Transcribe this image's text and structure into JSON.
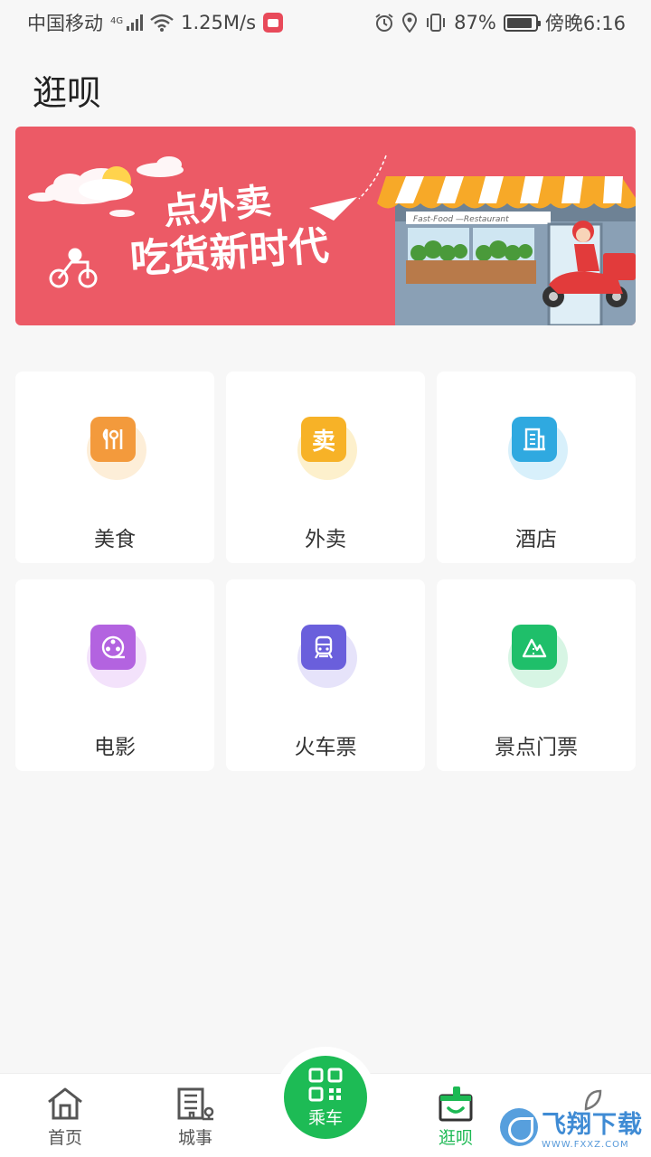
{
  "status_bar": {
    "carrier": "中国移动",
    "network": "4G",
    "speed": "1.25M/s",
    "battery": "87%",
    "time": "傍晚6:16"
  },
  "header": {
    "title": "逛呗"
  },
  "banner": {
    "line1": "点外卖",
    "line2": "吃货新时代",
    "sign": "Fast-Food —Restaurant"
  },
  "categories": [
    {
      "label": "美食",
      "icon": "food-icon",
      "color": "#f39a3c"
    },
    {
      "label": "外卖",
      "icon": "takeout-icon",
      "color": "#f7b227"
    },
    {
      "label": "酒店",
      "icon": "hotel-icon",
      "color": "#2fa9e0"
    },
    {
      "label": "电影",
      "icon": "movie-icon",
      "color": "#b363e0"
    },
    {
      "label": "火车票",
      "icon": "train-icon",
      "color": "#6a5fdc"
    },
    {
      "label": "景点门票",
      "icon": "scenic-icon",
      "color": "#1fbf6a"
    }
  ],
  "nav": {
    "home": "首页",
    "city": "城事",
    "ride": "乘车",
    "shop": "逛呗",
    "active": "逛呗"
  },
  "watermark": {
    "main": "飞翔下载",
    "sub": "WWW.FXXZ.COM"
  }
}
